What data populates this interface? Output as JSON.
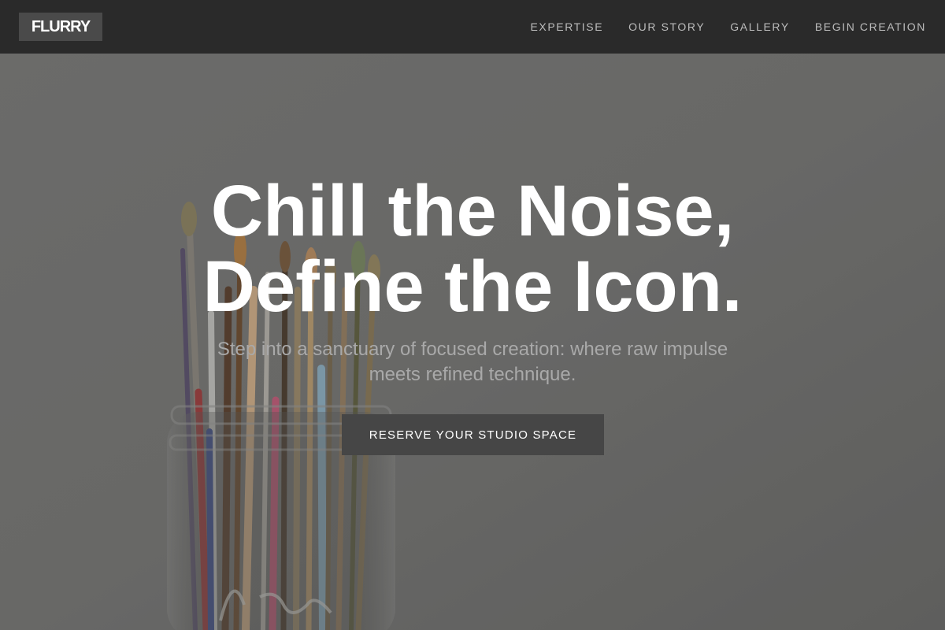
{
  "brand": {
    "logo": "FLURRY"
  },
  "nav": {
    "items": [
      {
        "label": "EXPERTISE"
      },
      {
        "label": "OUR STORY"
      },
      {
        "label": "GALLERY"
      },
      {
        "label": "BEGIN CREATION"
      }
    ]
  },
  "hero": {
    "title_line1": "Chill the Noise,",
    "title_line2": "Define the Icon.",
    "subtitle": "Step into a sanctuary of focused creation: where raw impulse meets refined technique.",
    "cta_label": "RESERVE YOUR STUDIO SPACE",
    "background_image": "jar-of-paintbrushes"
  },
  "colors": {
    "navbar_bg": "#2a2a2a",
    "logo_bg": "#4a4a4a",
    "cta_bg": "#464646",
    "title_text": "#ffffff",
    "subtitle_text": "#a9a9a9"
  }
}
